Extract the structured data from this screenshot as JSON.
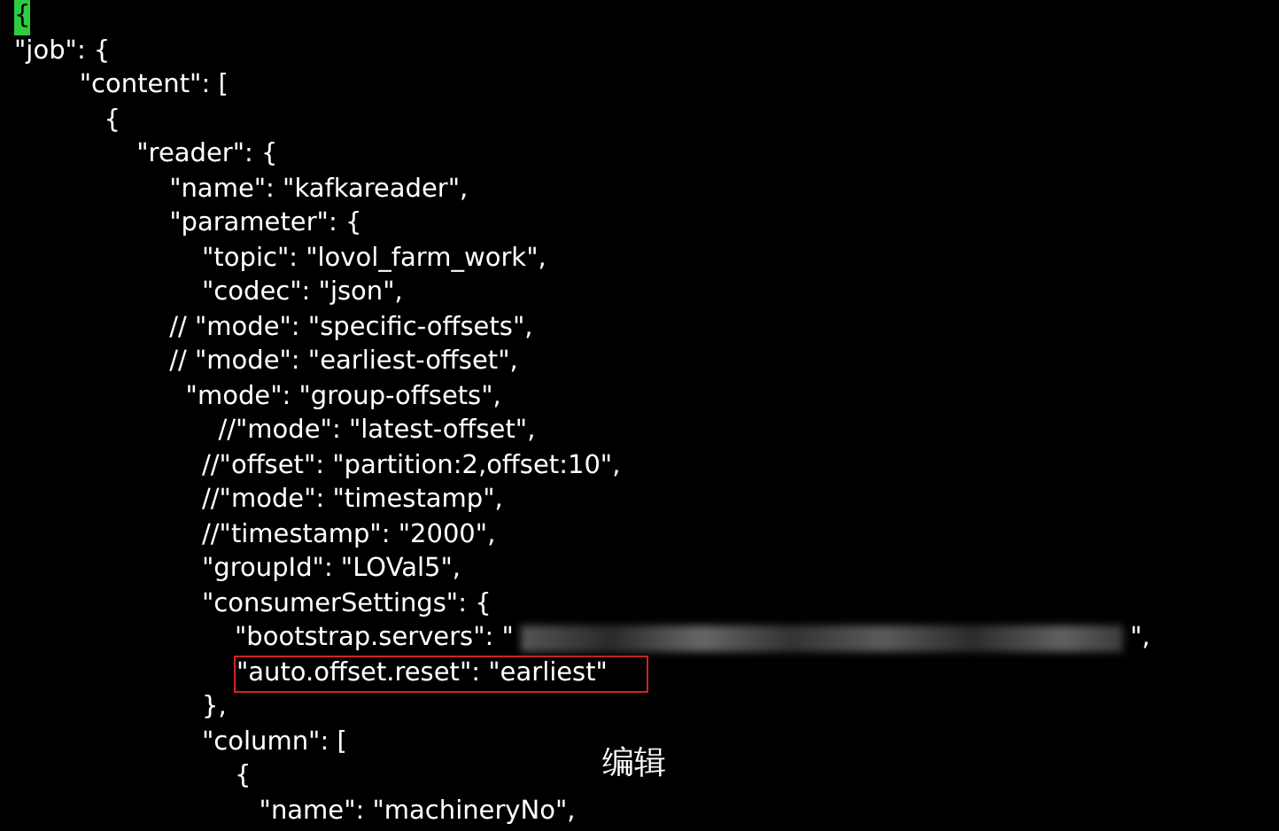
{
  "editor": {
    "lines": [
      {
        "kind": "cursor",
        "text": "{"
      },
      {
        "kind": "code",
        "text": "\"job\": {"
      },
      {
        "kind": "code",
        "text": "        \"content\": ["
      },
      {
        "kind": "code",
        "text": "           {"
      },
      {
        "kind": "code",
        "text": "               \"reader\": {"
      },
      {
        "kind": "code",
        "text": "                   \"name\": \"kafkareader\","
      },
      {
        "kind": "code",
        "text": "                   \"parameter\": {"
      },
      {
        "kind": "code",
        "text": "                       \"topic\": \"lovol_farm_work\","
      },
      {
        "kind": "code",
        "text": "                       \"codec\": \"json\","
      },
      {
        "kind": "code",
        "text": "                   // \"mode\": \"specific-offsets\","
      },
      {
        "kind": "code",
        "text": "                   // \"mode\": \"earliest-offset\","
      },
      {
        "kind": "code",
        "text": "                     \"mode\": \"group-offsets\","
      },
      {
        "kind": "code",
        "text": "                         //\"mode\": \"latest-offset\","
      },
      {
        "kind": "code",
        "text": "                       //\"offset\": \"partition:2,offset:10\","
      },
      {
        "kind": "code",
        "text": "                       //\"mode\": \"timestamp\","
      },
      {
        "kind": "code",
        "text": "                       //\"timestamp\": \"2000\","
      },
      {
        "kind": "code",
        "text": "                       \"groupId\": \"LOVal5\","
      },
      {
        "kind": "code",
        "text": "                       \"consumerSettings\": {"
      },
      {
        "kind": "redacted",
        "text": "                           \"bootstrap.servers\": \"",
        "suffix": "\","
      },
      {
        "kind": "highlighted",
        "text": "                           \"auto.offset.reset\": \"earliest\""
      },
      {
        "kind": "code",
        "text": "                       },"
      },
      {
        "kind": "code",
        "text": "                       \"column\": ["
      },
      {
        "kind": "code",
        "text": "                           {"
      },
      {
        "kind": "code",
        "text": "                              \"name\": \"machineryNo\","
      }
    ]
  },
  "overlay_label": "编辑"
}
